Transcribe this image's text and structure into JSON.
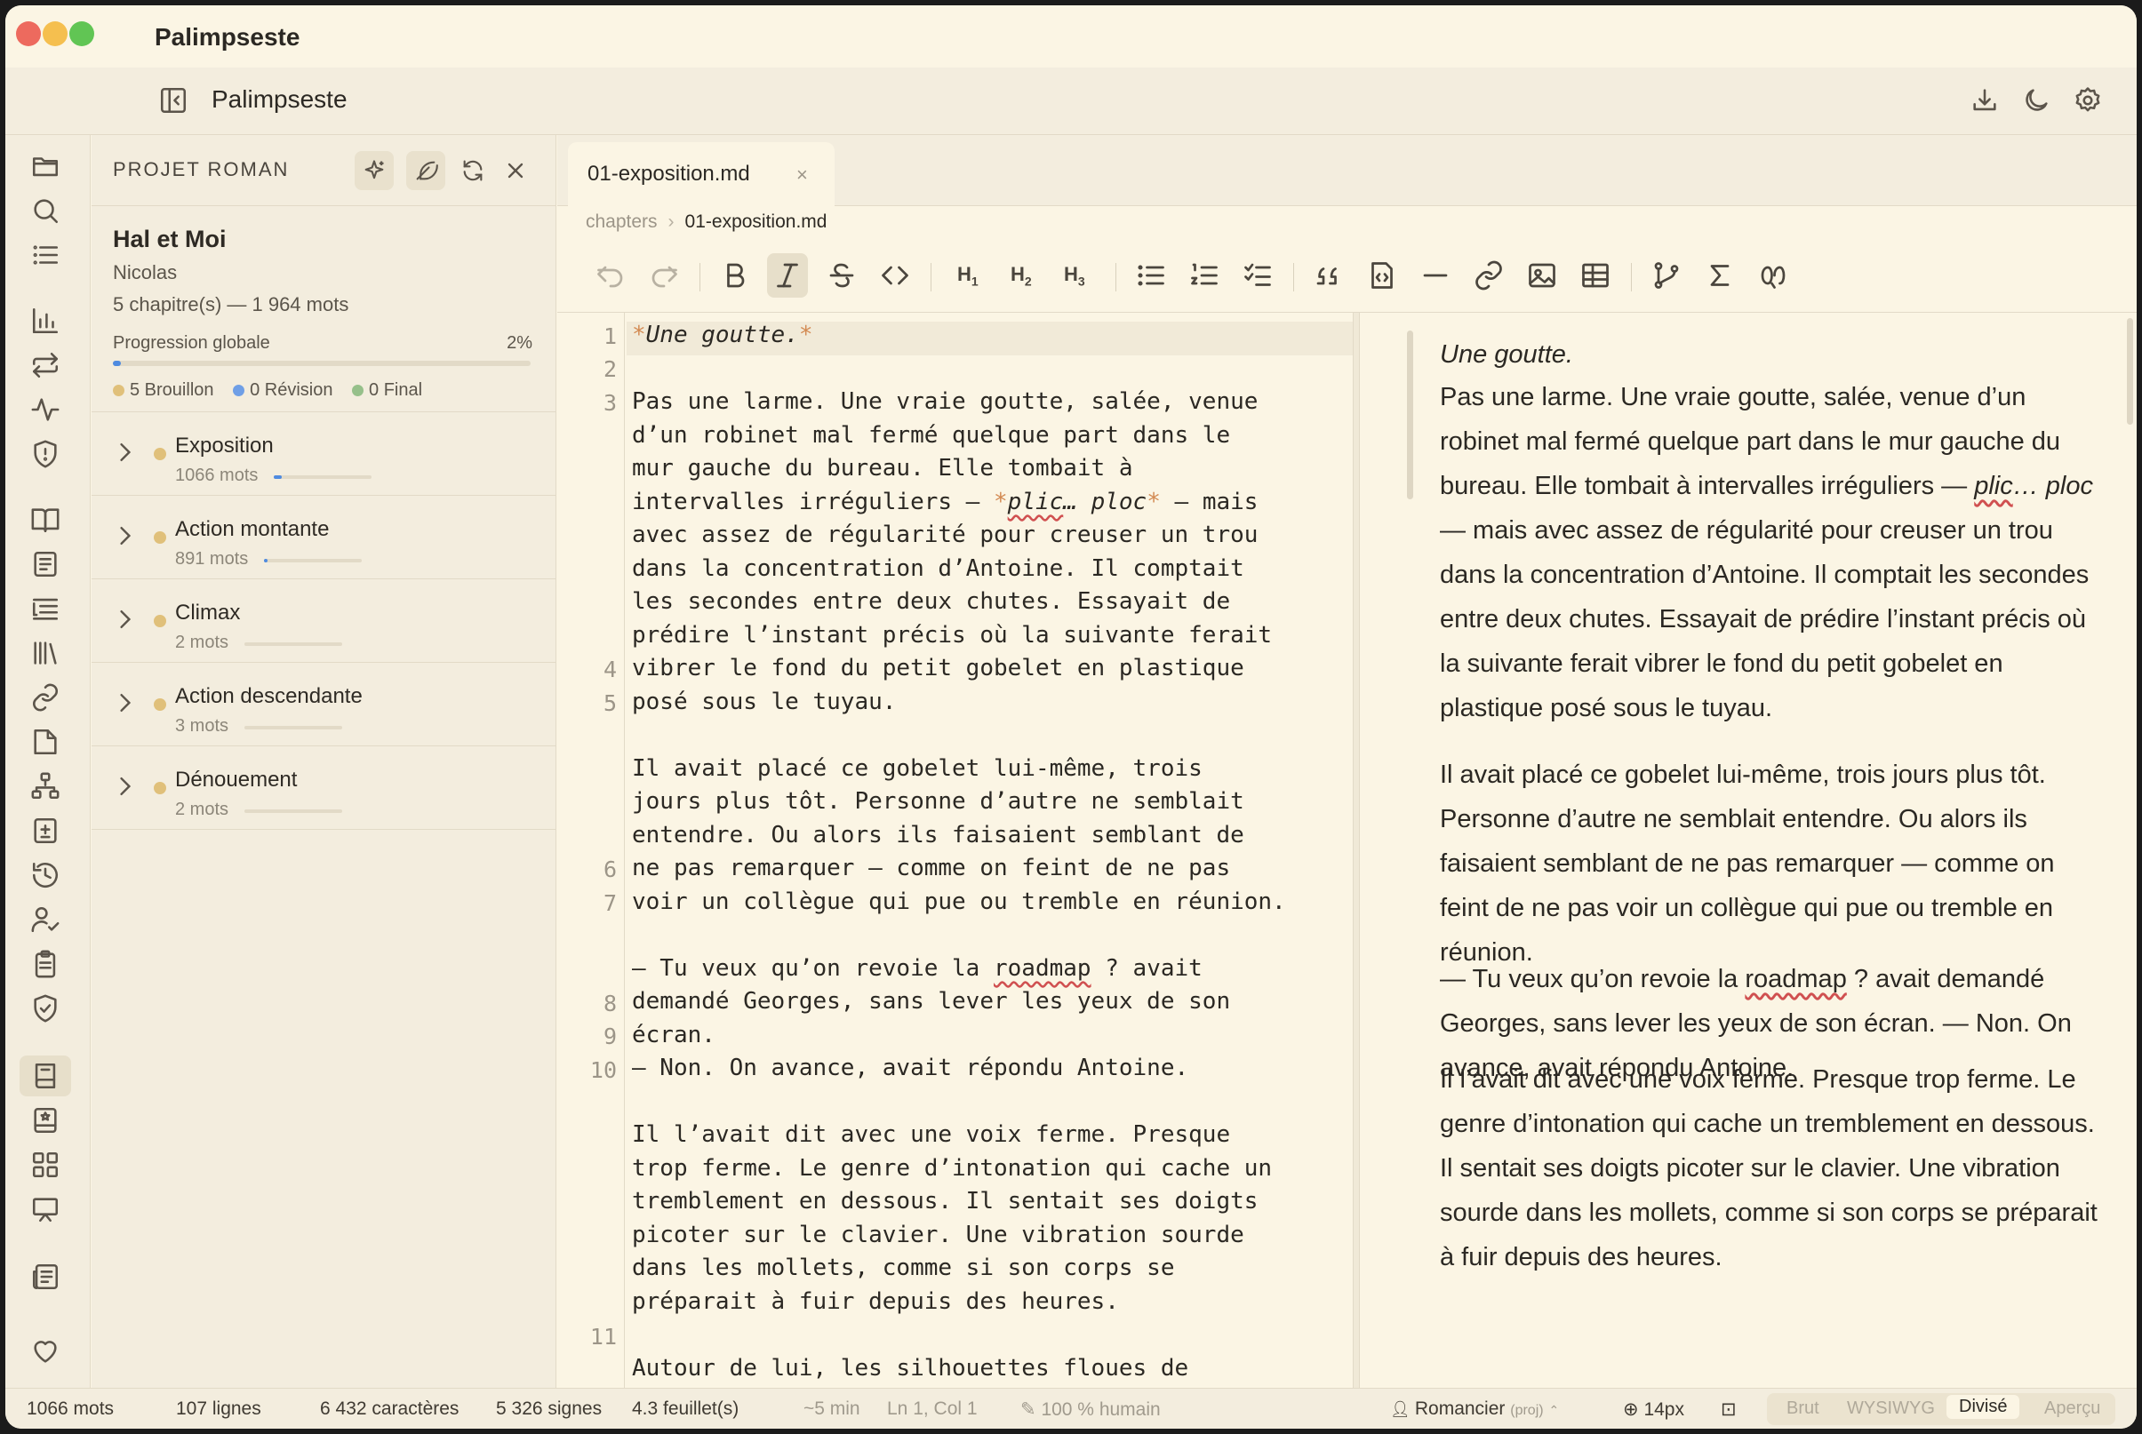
{
  "window": {
    "title": "Palimpseste"
  },
  "topbar": {
    "title": "Palimpseste",
    "icons": [
      "sidebar-collapse-icon",
      "download-icon",
      "moon-icon",
      "gear-icon"
    ]
  },
  "rail": {
    "icons": [
      "folder-icon",
      "search-icon",
      "list-icon",
      "bar-chart-icon",
      "swap-icon",
      "activity-icon",
      "shield-alert-icon",
      "book-open-icon",
      "document-icon",
      "outline-icon",
      "library-icon",
      "link-icon",
      "note-icon",
      "tree-icon",
      "file-plus-icon",
      "history-icon",
      "user-check-icon",
      "clipboard-icon",
      "shield-check-icon",
      "book-active-icon",
      "book-mark-icon",
      "grid-icon",
      "presentation-icon",
      "newspaper-icon",
      "heart-icon"
    ]
  },
  "project": {
    "header": "PROJET ROMAN",
    "book_title": "Hal et Moi",
    "author": "Nicolas",
    "counts": "5 chapitre(s) — 1 964 mots",
    "progress_label": "Progression globale",
    "progress_value": "2%",
    "progress_fraction": 0.02,
    "legend": [
      "5 Brouillon",
      "0 Révision",
      "0 Final"
    ],
    "legend_colors": [
      "#e0c07a",
      "#6f9fe6",
      "#96c08a"
    ],
    "chapters": [
      {
        "name": "Exposition",
        "words": "1066 mots",
        "fraction": 0.08
      },
      {
        "name": "Action montante",
        "words": "891 mots",
        "fraction": 0.03
      },
      {
        "name": "Climax",
        "words": "2 mots",
        "fraction": 0
      },
      {
        "name": "Action descendante",
        "words": "3 mots",
        "fraction": 0
      },
      {
        "name": "Dénouement",
        "words": "2 mots",
        "fraction": 0
      }
    ]
  },
  "tab": {
    "label": "01-exposition.md",
    "close": "×"
  },
  "breadcrumb": {
    "parent": "chapters",
    "sep": "›",
    "current": "01-exposition.md"
  },
  "toolbar": {
    "h1": "H",
    "h2": "H",
    "h3": "H",
    "n1": "1",
    "n2": "2",
    "n3": "3"
  },
  "editor": {
    "line_numbers": [
      "1",
      "2",
      "3",
      "4",
      "5",
      "6",
      "7",
      "8",
      "9",
      "10",
      "11"
    ],
    "lines": [
      "Pas une larme. Une vraie goutte, salée, venue",
      "d’un robinet mal fermé quelque part dans le",
      "mur gauche du bureau. Elle tombait à",
      "avec assez de régularité pour creuser un trou",
      "dans la concentration d’Antoine. Il comptait",
      "les secondes entre deux chutes. Essayait de",
      "prédire l’instant précis où la suivante ferait",
      "vibrer le fond du petit gobelet en plastique",
      "posé sous le tuyau.",
      "Il avait placé ce gobelet lui-même, trois",
      "jours plus tôt. Personne d’autre ne semblait",
      "entendre. Ou alors ils faisaient semblant de",
      "ne pas remarquer — comme on feint de ne pas",
      "voir un collègue qui pue ou tremble en réunion.",
      "demandé Georges, sans lever les yeux de son",
      "écran.",
      "— Non. On avance, avait répondu Antoine.",
      "Il l’avait dit avec une voix ferme. Presque",
      "trop ferme. Le genre d’intonation qui cache un",
      "tremblement en dessous. Il sentait ses doigts",
      "picoter sur le clavier. Une vibration sourde",
      "dans les mollets, comme si son corps se",
      "préparait à fuir depuis des heures.",
      "Autour de lui, les silhouettes floues de"
    ],
    "l1": {
      "a": "*",
      "t": "Une goutte.",
      "b": "*"
    },
    "l3": {
      "pre": "intervalles irréguliers — ",
      "a": "*",
      "w": "plic",
      "mid": "… ploc",
      "b": "*",
      "post": " — mais"
    },
    "l7": {
      "pre": "— Tu veux qu’on revoie la ",
      "w": "roadmap",
      "post": " ? avait"
    }
  },
  "preview": {
    "p1": "Une goutte.",
    "p2a": "Pas une larme. Une vraie goutte, salée, venue d’un robinet mal fermé quelque part dans le mur gauche du bureau. Elle tombait à intervalles irréguliers — ",
    "p2w": "plic",
    "p2b": "… ploc",
    "p2c": " — mais avec assez de régularité pour creuser un trou dans la concentration d’Antoine. Il comptait les secondes entre deux chutes. Essayait de prédire l’instant précis où la suivante ferait vibrer le fond du petit gobelet en plastique posé sous le tuyau.",
    "p3": "Il avait placé ce gobelet lui-même, trois jours plus tôt. Personne d’autre ne semblait entendre. Ou alors ils faisaient semblant de ne pas remarquer — comme on feint de ne pas voir un collègue qui pue ou tremble en réunion.",
    "p4a": "— Tu veux qu’on revoie la ",
    "p4w": "roadmap",
    "p4b": " ? avait demandé Georges, sans lever les yeux de son écran. — Non. On avance, avait répondu Antoine.",
    "p5": "Il l’avait dit avec une voix ferme. Presque trop ferme. Le genre d’intonation qui cache un tremblement en dessous. Il sentait ses doigts picoter sur le clavier. Une vibration sourde dans les mollets, comme si son corps se préparait à fuir depuis des heures."
  },
  "status": {
    "words": "1066 mots",
    "lines": "107 lignes",
    "chars": "6 432 caractères",
    "signs": "5 326 signes",
    "sheets": "4.3 feuillet(s)",
    "time": "~5 min",
    "cursor": "Ln 1, Col 1",
    "human": "100 % humain",
    "profile": "Romancier",
    "profile_tag": "(proj)",
    "zoom": "14px",
    "modes": [
      "Brut",
      "WYSIWYG",
      "Divisé",
      "Aperçu"
    ],
    "active_mode": "Divisé"
  },
  "colors": {
    "accent": "#4f8be0",
    "draft": "#e0c07a",
    "background": "#fbf5e4",
    "panel": "#f3edde"
  }
}
